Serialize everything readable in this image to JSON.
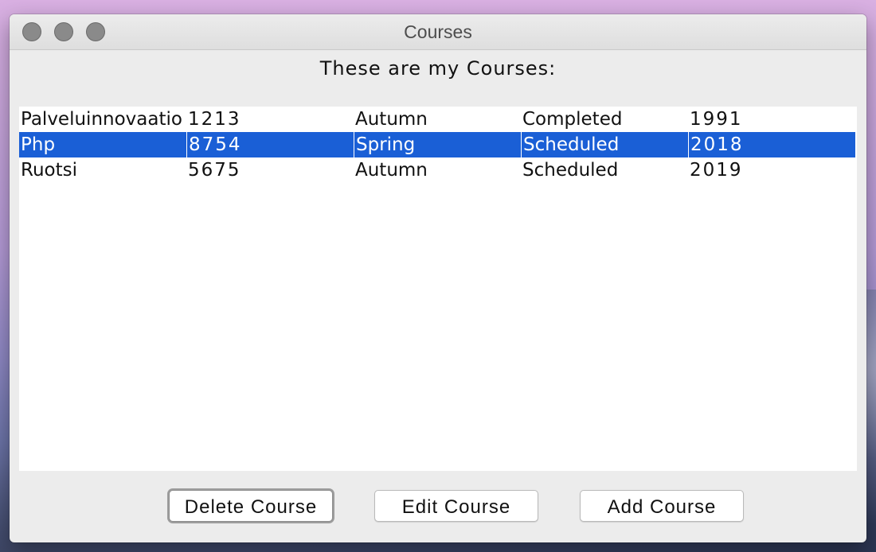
{
  "window": {
    "title": "Courses"
  },
  "heading": "These are my Courses:",
  "courses": [
    {
      "name": "Palveluinnovaatio",
      "code": "1213",
      "semester": "Autumn",
      "status": "Completed",
      "year": "1991",
      "selected": false
    },
    {
      "name": "Php",
      "code": "8754",
      "semester": "Spring",
      "status": "Scheduled",
      "year": "2018",
      "selected": true
    },
    {
      "name": "Ruotsi",
      "code": "5675",
      "semester": "Autumn",
      "status": "Scheduled",
      "year": "2019",
      "selected": false
    }
  ],
  "buttons": {
    "delete_label": "Delete Course",
    "edit_label": "Edit Course",
    "add_label": "Add Course"
  },
  "colors": {
    "selection": "#1a5fd6",
    "window_bg": "#ececec",
    "traffic_light": "#8a8a8a"
  }
}
